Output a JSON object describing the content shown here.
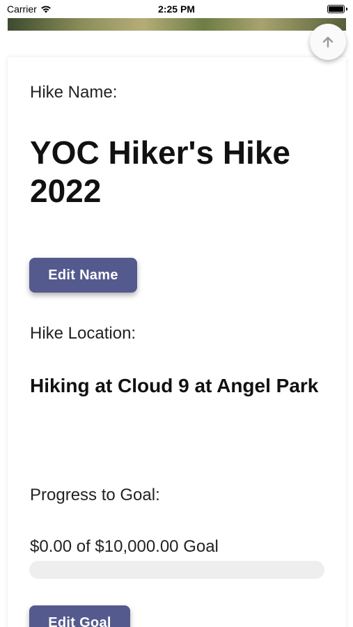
{
  "status_bar": {
    "carrier": "Carrier",
    "time": "2:25 PM"
  },
  "hike": {
    "name_label": "Hike Name:",
    "name": "YOC Hiker's Hike 2022",
    "edit_name_label": "Edit Name",
    "location_label": "Hike Location:",
    "location": "Hiking at Cloud 9 at Angel Park",
    "progress_label": "Progress to Goal:",
    "goal_text": "$0.00 of $10,000.00 Goal",
    "progress_fraction": 0.0,
    "edit_goal_label": "Edit Goal"
  },
  "icons": {
    "scroll_top": "arrow-up-icon",
    "wifi": "wifi-icon",
    "battery": "battery-icon"
  },
  "colors": {
    "button": "#555a8e",
    "progress_track": "#eeeeee"
  }
}
